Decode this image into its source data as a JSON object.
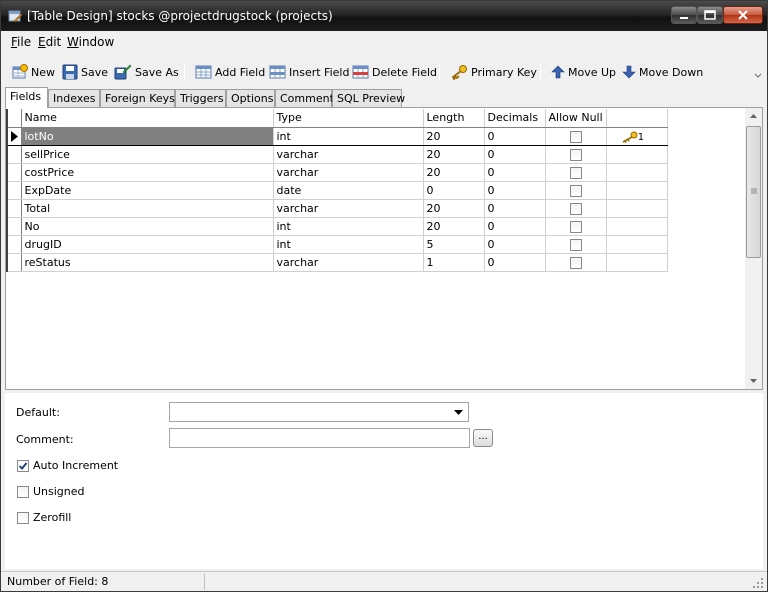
{
  "window": {
    "title": "[Table Design] stocks @projectdrugstock (projects)"
  },
  "menu": {
    "file": {
      "accel": "F",
      "rest": "ile"
    },
    "edit": {
      "accel": "E",
      "rest": "dit"
    },
    "window": {
      "accel": "W",
      "rest": "indow"
    }
  },
  "toolbar": {
    "new": "New",
    "save": "Save",
    "save_as": "Save As",
    "add_field": "Add Field",
    "insert_field": "Insert Field",
    "delete_field": "Delete Field",
    "primary_key": "Primary Key",
    "move_up": "Move Up",
    "move_down": "Move Down"
  },
  "tabs": [
    "Fields",
    "Indexes",
    "Foreign Keys",
    "Triggers",
    "Options",
    "Comment",
    "SQL Preview"
  ],
  "grid": {
    "columns": [
      "Name",
      "Type",
      "Length",
      "Decimals",
      "Allow Null",
      ""
    ],
    "rows": [
      {
        "name": "lotNo",
        "type": "int",
        "length": "20",
        "decimals": "0",
        "allow_null": false,
        "key": "1"
      },
      {
        "name": "sellPrice",
        "type": "varchar",
        "length": "20",
        "decimals": "0",
        "allow_null": false,
        "key": ""
      },
      {
        "name": "costPrice",
        "type": "varchar",
        "length": "20",
        "decimals": "0",
        "allow_null": false,
        "key": ""
      },
      {
        "name": "ExpDate",
        "type": "date",
        "length": "0",
        "decimals": "0",
        "allow_null": false,
        "key": ""
      },
      {
        "name": "Total",
        "type": "varchar",
        "length": "20",
        "decimals": "0",
        "allow_null": false,
        "key": ""
      },
      {
        "name": "No",
        "type": "int",
        "length": "20",
        "decimals": "0",
        "allow_null": false,
        "key": ""
      },
      {
        "name": "drugID",
        "type": "int",
        "length": "5",
        "decimals": "0",
        "allow_null": false,
        "key": ""
      },
      {
        "name": "reStatus",
        "type": "varchar",
        "length": "1",
        "decimals": "0",
        "allow_null": false,
        "key": ""
      }
    ]
  },
  "properties": {
    "default_label": "Default:",
    "default_value": "",
    "comment_label": "Comment:",
    "comment_value": "",
    "comment_button": "...",
    "auto_increment": {
      "label": "Auto Increment",
      "checked": true
    },
    "unsigned": {
      "label": "Unsigned",
      "checked": false
    },
    "zerofill": {
      "label": "Zerofill",
      "checked": false
    }
  },
  "status": {
    "field_count": "Number of Field: 8"
  }
}
